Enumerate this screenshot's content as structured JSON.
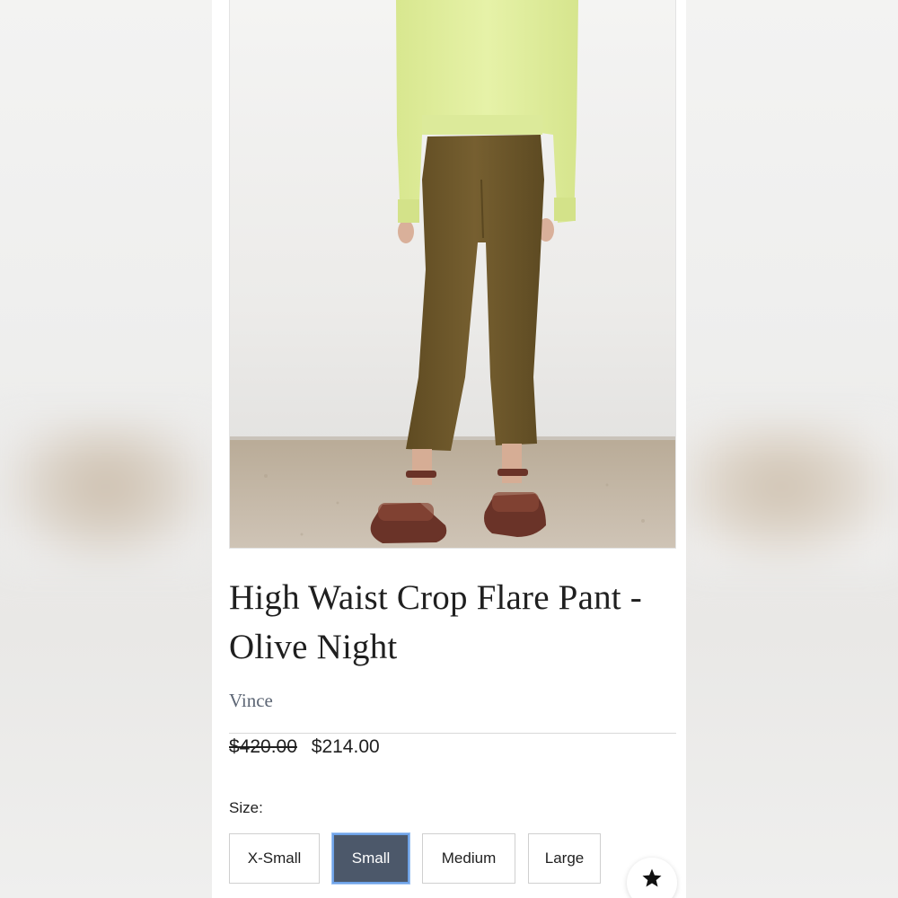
{
  "product": {
    "title": "High Waist Crop Flare Pant - Olive Night",
    "brand": "Vince",
    "price_original": "$420.00",
    "price_sale": "$214.00"
  },
  "size": {
    "label": "Size:",
    "options": [
      "X-Small",
      "Small",
      "Medium",
      "Large"
    ],
    "selected": "Small"
  },
  "icons": {
    "favorite": "star-icon"
  },
  "colors": {
    "selected_size_bg": "#4c586a",
    "selected_size_border": "#6fa3e8",
    "brand_text": "#5d6675",
    "top": "#e3f0a2",
    "pants": "#6f5a2c",
    "sandals": "#6a3328"
  }
}
